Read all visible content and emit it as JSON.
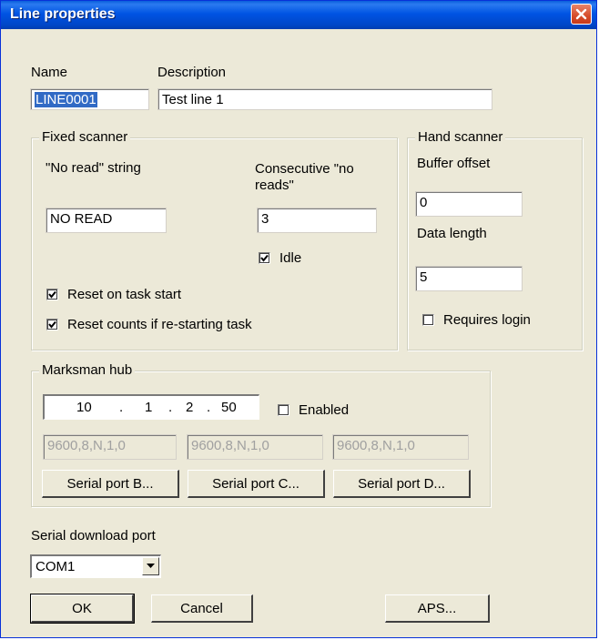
{
  "window": {
    "title": "Line properties"
  },
  "name": {
    "label": "Name",
    "value": "LINE0001"
  },
  "description": {
    "label": "Description",
    "value": "Test line 1"
  },
  "fixed_scanner": {
    "title": "Fixed scanner",
    "no_read_label": "\"No read\" string",
    "no_read_value": "NO READ",
    "consecutive_label_1": "Consecutive \"no",
    "consecutive_label_2": "reads\"",
    "consecutive_value": "3",
    "idle_label": "Idle",
    "idle_checked": true,
    "reset_task_label": "Reset on task start",
    "reset_task_checked": true,
    "reset_counts_label": "Reset counts if re-starting task",
    "reset_counts_checked": true
  },
  "hand_scanner": {
    "title": "Hand scanner",
    "buffer_offset_label": "Buffer offset",
    "buffer_offset_value": "0",
    "data_length_label": "Data length",
    "data_length_value": "5",
    "requires_login_label": "Requires login",
    "requires_login_checked": false
  },
  "marksman_hub": {
    "title": "Marksman hub",
    "ip": [
      "10",
      "1",
      "2",
      "50"
    ],
    "ip_dot": ".",
    "enabled_label": "Enabled",
    "enabled_checked": false,
    "port_settings": [
      "9600,8,N,1,0",
      "9600,8,N,1,0",
      "9600,8,N,1,0"
    ],
    "port_buttons": [
      "Serial port B...",
      "Serial port C...",
      "Serial port D..."
    ]
  },
  "download_port": {
    "label": "Serial download port",
    "value": "COM1"
  },
  "buttons": {
    "ok": "OK",
    "cancel": "Cancel",
    "aps": "APS..."
  }
}
